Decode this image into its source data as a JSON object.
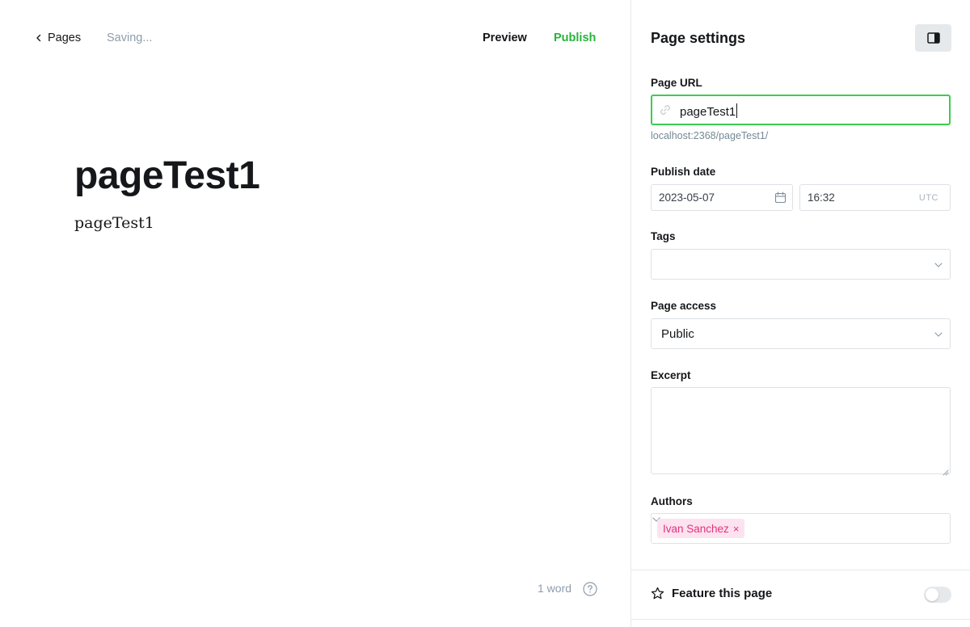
{
  "editor": {
    "back_label": "Pages",
    "status": "Saving...",
    "preview_label": "Preview",
    "publish_label": "Publish",
    "title": "pageTest1",
    "body": "pageTest1",
    "word_count": "1 word"
  },
  "settings": {
    "title": "Page settings",
    "url": {
      "label": "Page URL",
      "value": "pageTest1",
      "hint": "localhost:2368/pageTest1/"
    },
    "publish_date": {
      "label": "Publish date",
      "date": "2023-05-07",
      "time": "16:32",
      "timezone": "UTC"
    },
    "tags": {
      "label": "Tags",
      "value": ""
    },
    "page_access": {
      "label": "Page access",
      "value": "Public"
    },
    "excerpt": {
      "label": "Excerpt",
      "value": ""
    },
    "authors": {
      "label": "Authors",
      "items": [
        "Ivan Sanchez"
      ],
      "remove_glyph": "×"
    },
    "feature": {
      "label": "Feature this page",
      "enabled": false
    }
  },
  "colors": {
    "accent_green": "#30cf43",
    "author_chip_bg": "#fde3ef",
    "author_chip_text": "#e2317e",
    "muted_text": "#8e9cac"
  },
  "icons": [
    "chevron-left-icon",
    "help-icon",
    "sidebar-toggle-icon",
    "link-icon",
    "calendar-icon",
    "chevron-down-icon",
    "star-icon",
    "resize-grip-icon"
  ]
}
